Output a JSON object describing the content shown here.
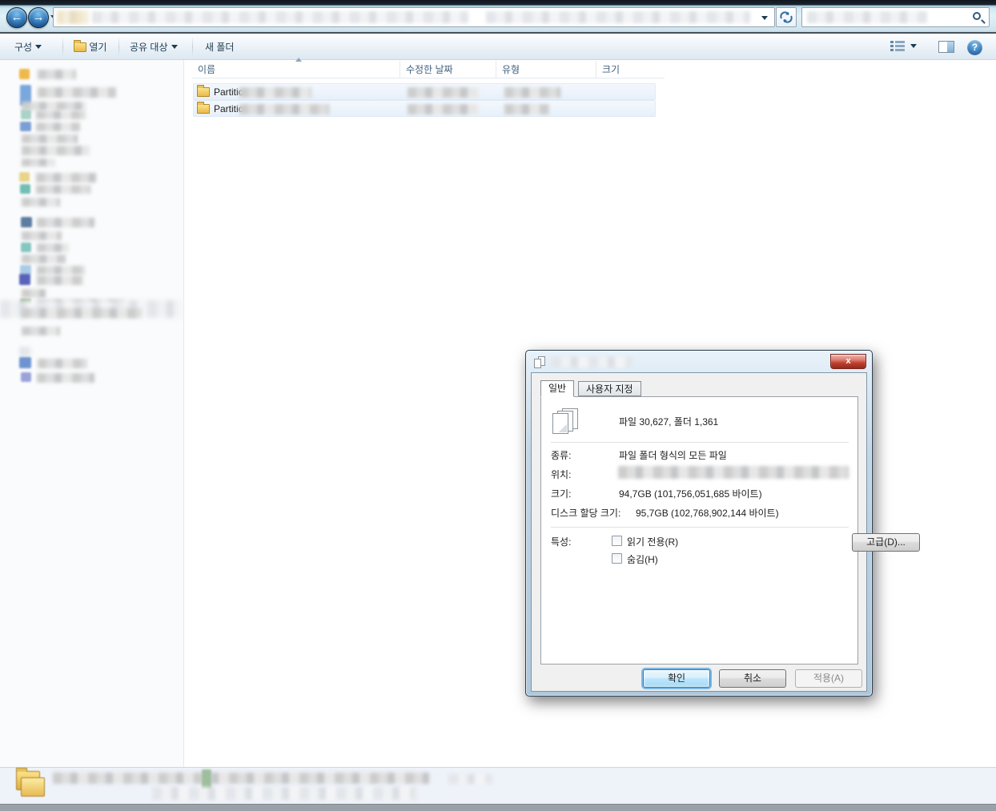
{
  "toolbar": {
    "organize_label": "구성",
    "open_label": "열기",
    "share_label": "공유 대상",
    "new_folder_label": "새 폴더"
  },
  "list": {
    "columns": [
      {
        "label": "이름"
      },
      {
        "label": "수정한 날짜"
      },
      {
        "label": "유형"
      },
      {
        "label": "크기"
      }
    ],
    "rows": [
      {
        "name": "Partitio"
      },
      {
        "name": "Partitio"
      }
    ]
  },
  "dialog": {
    "tabs": {
      "general": "일반",
      "customize": "사용자 지정"
    },
    "close_label": "x",
    "summary": "파일 30,627, 폴더 1,361",
    "type_label": "종류:",
    "type_value": "파일 폴더 형식의 모든 파일",
    "location_label": "위치:",
    "size_label": "크기:",
    "size_value": "94,7GB (101,756,051,685 바이트)",
    "disk_label": "디스크 할당 크기:",
    "disk_value": "95,7GB (102,768,902,144 바이트)",
    "attr_label": "특성:",
    "readonly_label": "읽기 전용(R)",
    "readonly_checked": false,
    "hidden_label": "숨김(H)",
    "hidden_checked": false,
    "advanced_label": "고급(D)...",
    "ok_label": "확인",
    "cancel_label": "취소",
    "apply_label": "적용(A)",
    "apply_enabled": false
  },
  "icons": {
    "back": "back-arrow",
    "forward": "forward-arrow",
    "refresh": "refresh-sync",
    "search": "magnifier",
    "help": "?"
  },
  "colors": {
    "selection_tint": "#e7f0fa",
    "default_button_glow": "#7ab8e6",
    "close_button_red": "#c3402e",
    "folder_yellow": "#e9b94a"
  }
}
